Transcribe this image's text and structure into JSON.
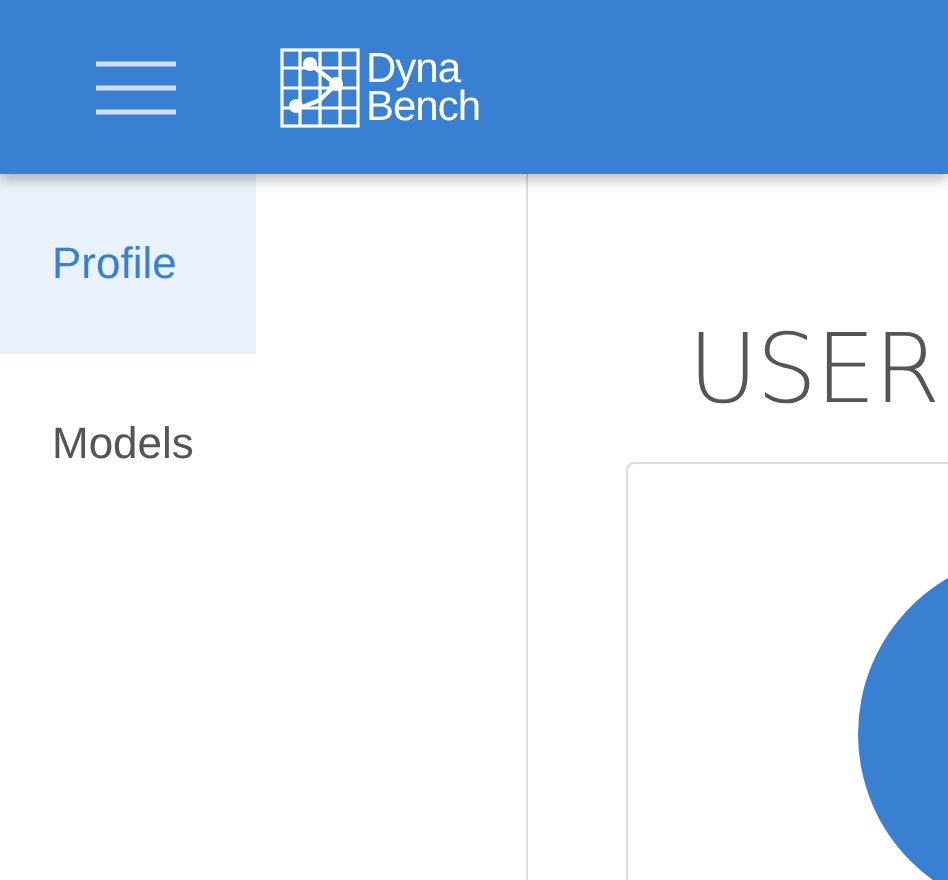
{
  "header": {
    "logo": {
      "line_1": "Dyna",
      "line_2": "Bench"
    }
  },
  "sidebar": {
    "items": [
      {
        "label": "Profile",
        "selected": true
      },
      {
        "label": "Models",
        "selected": false
      }
    ]
  },
  "main": {
    "heading": "USER",
    "card": {
      "kind": "avatar"
    }
  }
}
